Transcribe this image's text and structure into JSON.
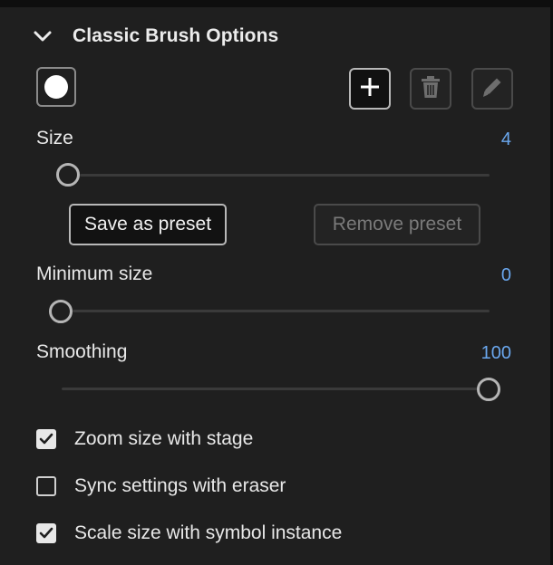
{
  "section": {
    "title": "Classic Brush Options",
    "expanded": true
  },
  "toolbar": {
    "add_icon": "plus-icon",
    "delete_icon": "trash-icon",
    "edit_icon": "pencil-icon"
  },
  "size": {
    "label": "Size",
    "value": "4",
    "fraction": 0.0
  },
  "preset": {
    "save_label": "Save as preset",
    "remove_label": "Remove preset"
  },
  "min_size": {
    "label": "Minimum size",
    "value": "0",
    "fraction": 0.0
  },
  "smoothing": {
    "label": "Smoothing",
    "value": "100",
    "fraction": 1.0
  },
  "options": [
    {
      "label": "Zoom size with stage",
      "checked": true
    },
    {
      "label": "Sync settings with eraser",
      "checked": false
    },
    {
      "label": "Scale size with symbol instance",
      "checked": true
    }
  ],
  "colors": {
    "background": "#1f1f1f",
    "accent_value": "#6aa7ee",
    "text": "#e8e8e8"
  }
}
